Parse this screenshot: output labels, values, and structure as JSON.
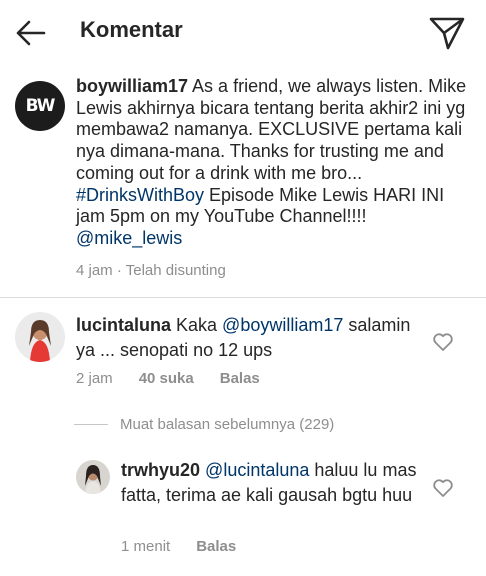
{
  "header": {
    "back_icon": "arrow-left-icon",
    "title": "Komentar",
    "send_icon": "paper-plane-icon"
  },
  "caption": {
    "avatar_text": "BW",
    "username": "boywilliam17",
    "body": " As a friend, we always listen. Mike Lewis akhirnya bicara tentang berita akhir2 ini yg membawa2 namanya. EXCLUSIVE pertama kali nya dimana-mana. Thanks for trusting me and coming out for a drink with me bro... ",
    "hashtag": "#DrinksWithBoy",
    "body2": " Episode Mike Lewis HARI INI jam 5pm on my YouTube Channel!!!! ",
    "mention": "@mike_lewis",
    "meta": "4 jam · Telah disunting"
  },
  "comments": [
    {
      "username": "lucintaluna",
      "pre": " Kaka ",
      "mention": "@boywilliam17",
      "post": " salamin ya ... senopati no 12 ups",
      "time": "2 jam",
      "likes": "40 suka",
      "reply": "Balas",
      "like_icon": "heart-outline-icon"
    },
    {
      "username": "trwhyu20",
      "pre": " ",
      "mention": "@lucintaluna",
      "post": " haluu lu mas fatta, terima ae kali gausah bgtu huu",
      "time": "1 menit",
      "reply": "Balas",
      "like_icon": "heart-outline-icon"
    }
  ],
  "view_previous": "Muat balasan sebelumnya (229)",
  "colors": {
    "text": "#262626",
    "meta": "#8e8e8e",
    "link": "#003569",
    "divider": "#dbdbdb"
  }
}
